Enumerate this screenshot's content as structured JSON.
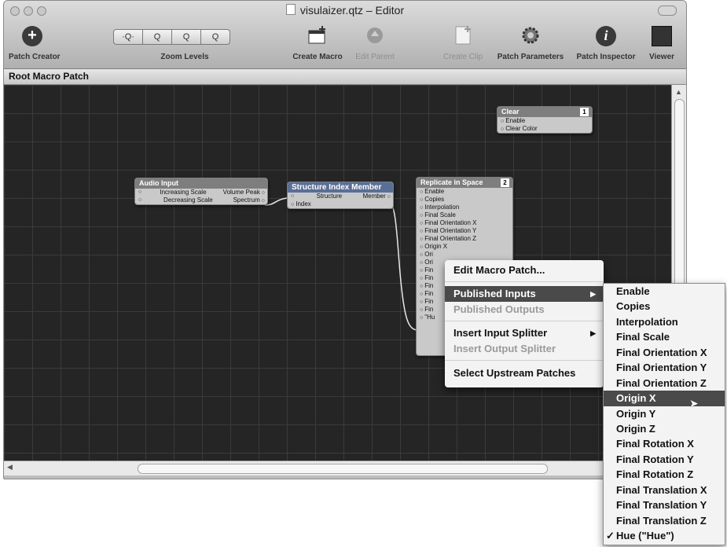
{
  "window": {
    "title": "visulaizer.qtz – Editor"
  },
  "toolbar": {
    "patch_creator": "Patch Creator",
    "zoom_label": "Zoom Levels",
    "zoom_buttons": [
      "·Q·",
      "Q",
      "Q",
      "Q"
    ],
    "create_macro": "Create Macro",
    "edit_parent": "Edit Parent",
    "create_clip": "Create Clip",
    "patch_parameters": "Patch Parameters",
    "patch_inspector": "Patch Inspector",
    "viewer": "Viewer"
  },
  "breadcrumb": "Root Macro Patch",
  "patches": {
    "clear": {
      "title": "Clear",
      "number": "1",
      "inputs": [
        "Enable",
        "Clear Color"
      ]
    },
    "audio_input": {
      "title": "Audio Input",
      "rows": [
        [
          "Increasing Scale",
          "Volume Peak"
        ],
        [
          "Decreasing Scale",
          "Spectrum"
        ]
      ]
    },
    "structure_index": {
      "title": "Structure Index Member",
      "rows": [
        [
          "Structure",
          "Member"
        ],
        [
          "Index",
          ""
        ]
      ]
    },
    "replicate": {
      "title": "Replicate in Space",
      "number": "2",
      "inputs": [
        "Enable",
        "Copies",
        "Interpolation",
        "Final Scale",
        "Final Orientation X",
        "Final Orientation Y",
        "Final Orientation Z",
        "Origin X",
        "Ori",
        "Ori",
        "Fin",
        "Fin",
        "Fin",
        "Fin",
        "Fin",
        "Fin",
        "\"Hu"
      ]
    }
  },
  "context_menu": {
    "edit_macro": "Edit Macro Patch...",
    "published_inputs": "Published Inputs",
    "published_outputs": "Published Outputs",
    "insert_input_splitter": "Insert Input Splitter",
    "insert_output_splitter": "Insert Output Splitter",
    "select_upstream": "Select Upstream Patches"
  },
  "submenu": {
    "items": [
      "Enable",
      "Copies",
      "Interpolation",
      "Final Scale",
      "Final Orientation X",
      "Final Orientation Y",
      "Final Orientation Z",
      "Origin X",
      "Origin Y",
      "Origin Z",
      "Final Rotation X",
      "Final Rotation Y",
      "Final Rotation Z",
      "Final Translation X",
      "Final Translation Y",
      "Final Translation Z",
      "Hue (\"Hue\")"
    ],
    "selected": "Origin X",
    "checked": "Hue (\"Hue\")",
    "check_mark": "✓"
  },
  "colors": {
    "canvas": "#252525",
    "menu_highlight": "#4a4a4a",
    "patch_header_gray": "#7e7e7e",
    "patch_header_blue": "#5a6f96"
  }
}
